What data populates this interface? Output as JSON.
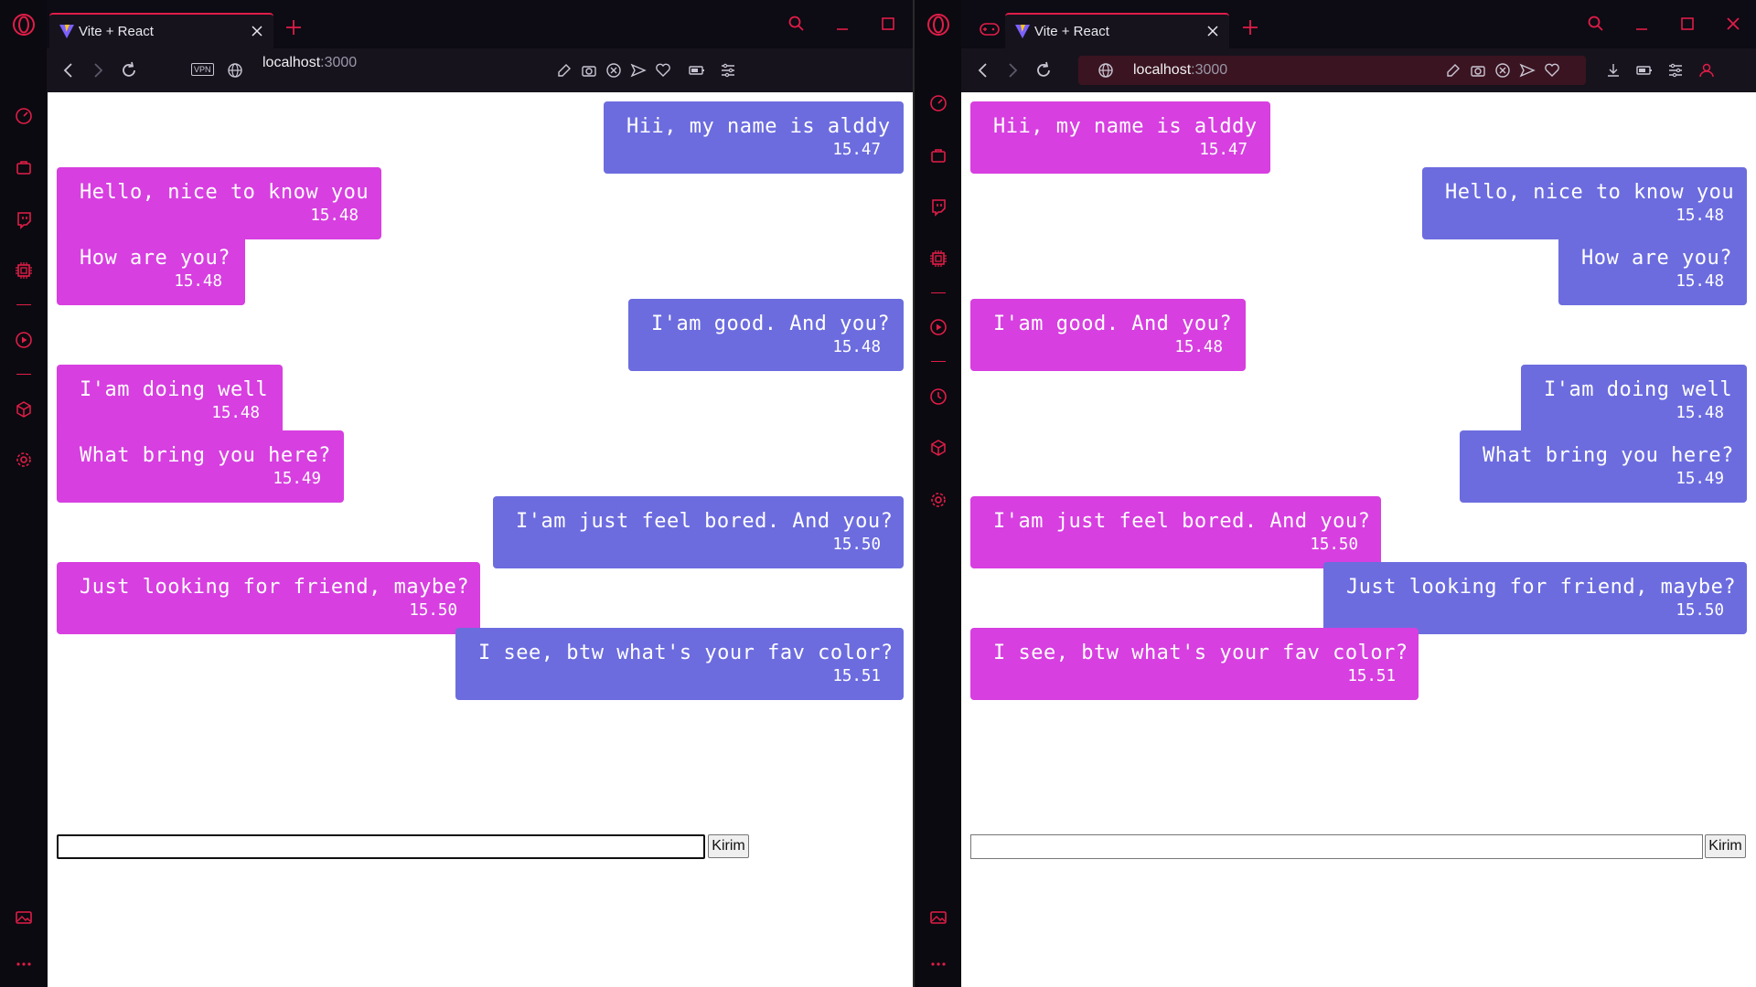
{
  "colors": {
    "accent": "#e11d48",
    "bubble_purple": "#6c6cdf",
    "bubble_magenta": "#d73fe0",
    "chrome_bg": "#17131d",
    "sidebar_bg": "#0b0a10"
  },
  "left_window": {
    "tab_title": "Vite + React",
    "url_host": "localhost",
    "url_port": ":3000",
    "vpn_label": "VPN",
    "send_label": "Kirim",
    "input_value": "",
    "messages": [
      {
        "text": "Hii, my name is alddy",
        "time": "15.47",
        "side": "right",
        "color": "purple"
      },
      {
        "text": "Hello, nice to know you",
        "time": "15.48",
        "side": "left",
        "color": "magenta"
      },
      {
        "text": "How are you?",
        "time": "15.48",
        "side": "left",
        "color": "magenta"
      },
      {
        "text": "I'am good. And you?",
        "time": "15.48",
        "side": "right",
        "color": "purple"
      },
      {
        "text": "I'am doing well",
        "time": "15.48",
        "side": "left",
        "color": "magenta"
      },
      {
        "text": "What bring you here?",
        "time": "15.49",
        "side": "left",
        "color": "magenta"
      },
      {
        "text": "I'am just feel bored. And you?",
        "time": "15.50",
        "side": "right",
        "color": "purple"
      },
      {
        "text": "Just looking for friend, maybe?",
        "time": "15.50",
        "side": "left",
        "color": "magenta"
      },
      {
        "text": "I see, btw what's your fav color?",
        "time": "15.51",
        "side": "right",
        "color": "purple"
      }
    ]
  },
  "right_window": {
    "tab_title": "Vite + React",
    "url_host": "localhost",
    "url_port": ":3000",
    "send_label": "Kirim",
    "input_value": "",
    "messages": [
      {
        "text": "Hii, my name is alddy",
        "time": "15.47",
        "side": "left",
        "color": "magenta"
      },
      {
        "text": "Hello, nice to know you",
        "time": "15.48",
        "side": "right",
        "color": "purple"
      },
      {
        "text": "How are you?",
        "time": "15.48",
        "side": "right",
        "color": "purple"
      },
      {
        "text": "I'am good. And you?",
        "time": "15.48",
        "side": "left",
        "color": "magenta"
      },
      {
        "text": "I'am doing well",
        "time": "15.48",
        "side": "right",
        "color": "purple"
      },
      {
        "text": "What bring you here?",
        "time": "15.49",
        "side": "right",
        "color": "purple"
      },
      {
        "text": "I'am just feel bored. And you?",
        "time": "15.50",
        "side": "left",
        "color": "magenta"
      },
      {
        "text": "Just looking for friend, maybe?",
        "time": "15.50",
        "side": "right",
        "color": "purple"
      },
      {
        "text": "I see, btw what's your fav color?",
        "time": "15.51",
        "side": "left",
        "color": "magenta"
      }
    ]
  }
}
